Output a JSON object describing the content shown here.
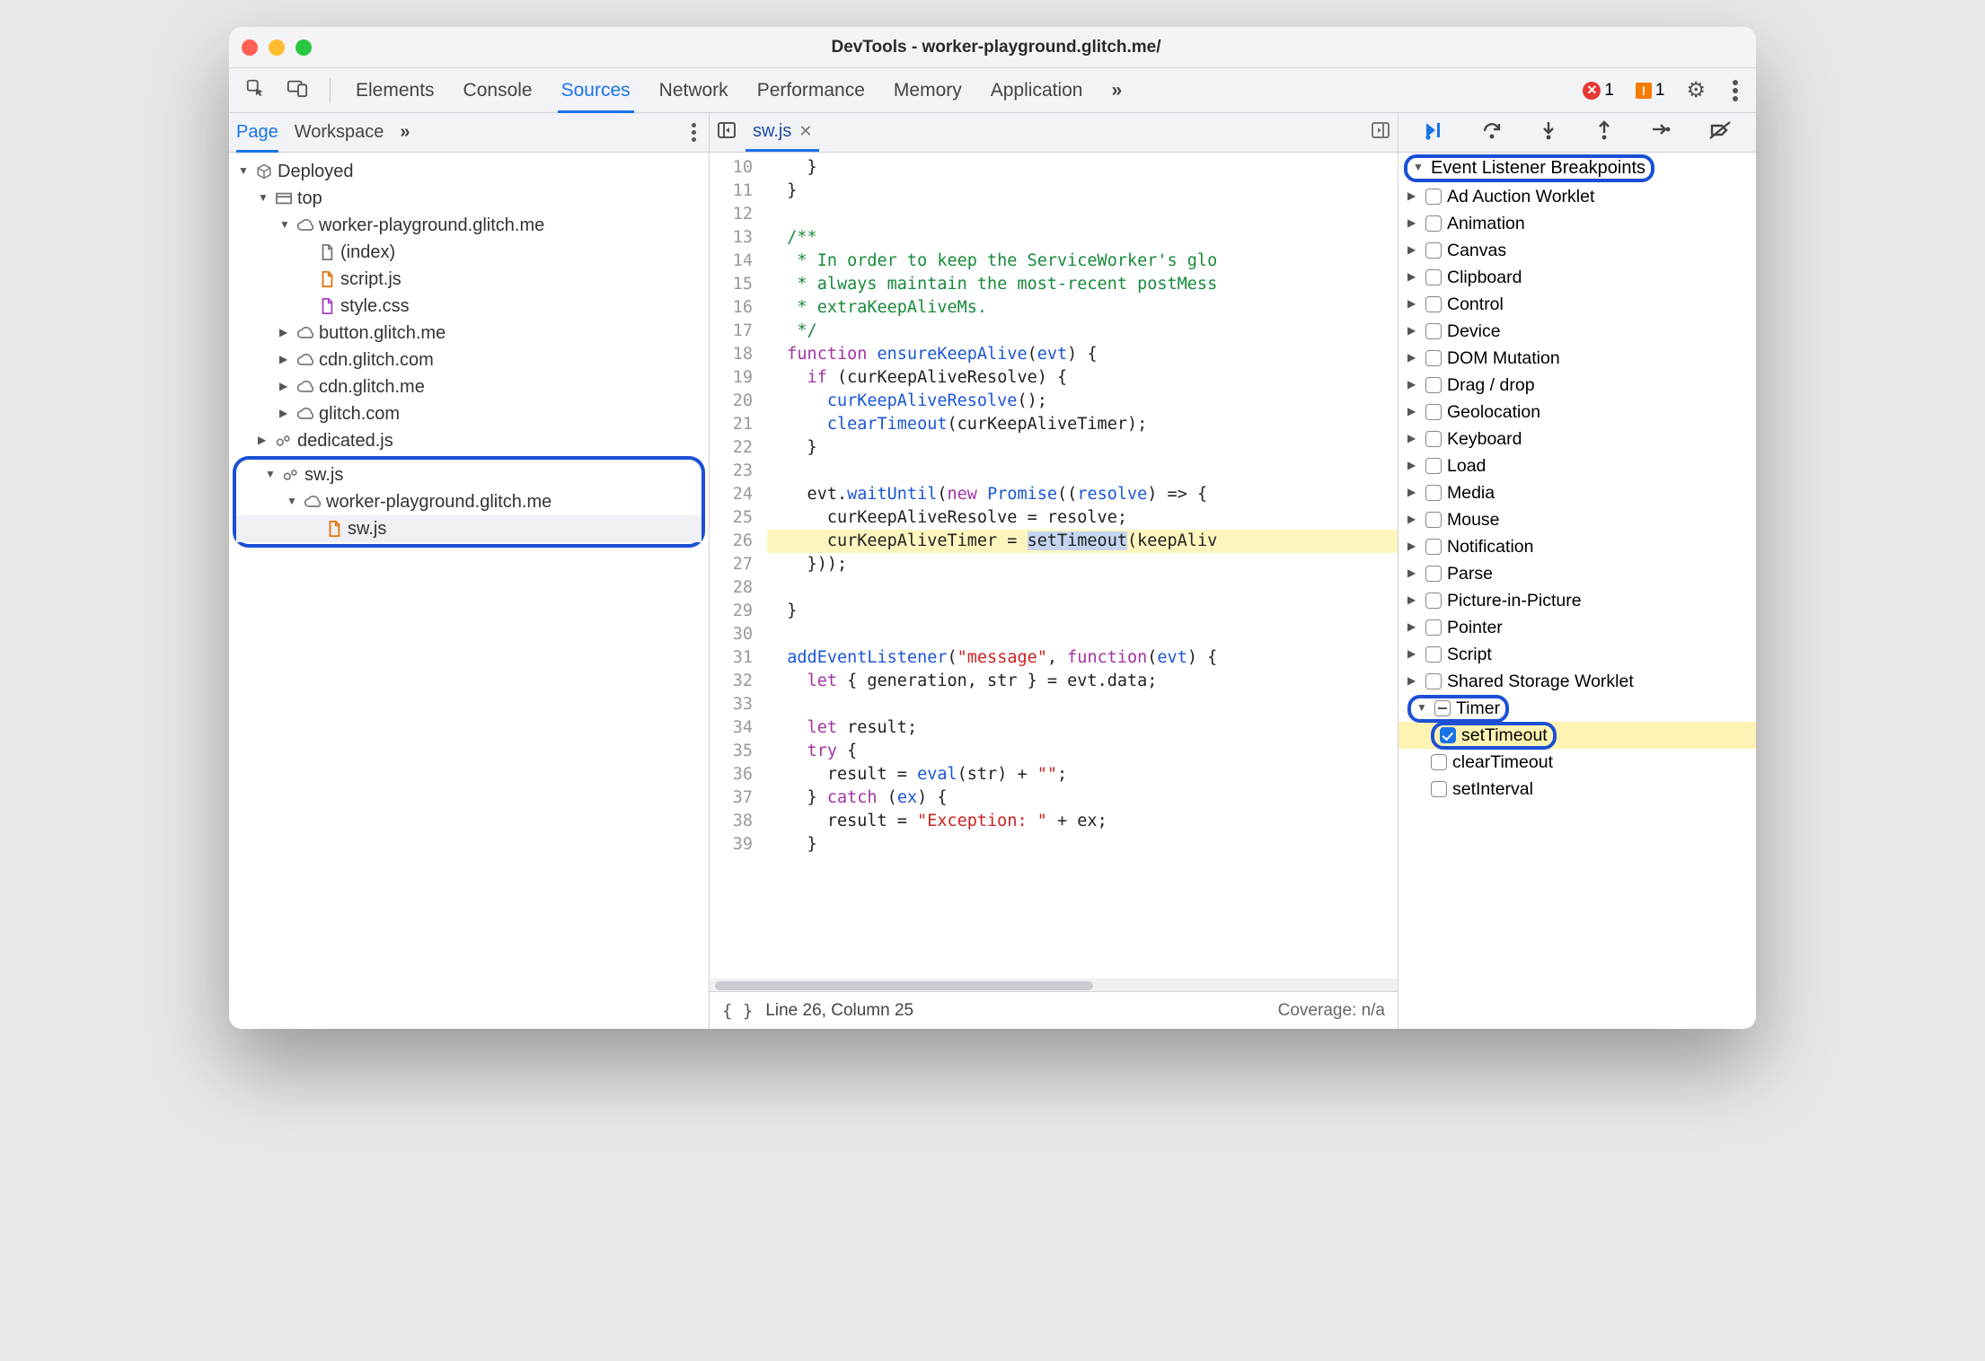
{
  "window": {
    "title": "DevTools - worker-playground.glitch.me/"
  },
  "toptabs": {
    "elements": "Elements",
    "console": "Console",
    "sources": "Sources",
    "network": "Network",
    "performance": "Performance",
    "memory": "Memory",
    "application": "Application",
    "more": "»",
    "error_count": "1",
    "warn_count": "1"
  },
  "left": {
    "tabs": {
      "page": "Page",
      "workspace": "Workspace",
      "more": "»"
    },
    "tree": {
      "deployed": "Deployed",
      "top": "top",
      "origin1": "worker-playground.glitch.me",
      "files1": [
        "(index)",
        "script.js",
        "style.css"
      ],
      "origins_more": [
        "button.glitch.me",
        "cdn.glitch.com",
        "cdn.glitch.me",
        "glitch.com"
      ],
      "dedicated": "dedicated.js",
      "sw": "sw.js",
      "sw_origin": "worker-playground.glitch.me",
      "sw_file": "sw.js"
    }
  },
  "center": {
    "file_tab": "sw.js",
    "lines": [
      {
        "n": 10,
        "t": "    }"
      },
      {
        "n": 11,
        "t": "  }"
      },
      {
        "n": 12,
        "t": ""
      },
      {
        "n": 13,
        "t": "  /**",
        "cls": "cm"
      },
      {
        "n": 14,
        "t": "   * In order to keep the ServiceWorker's glo",
        "cls": "cm"
      },
      {
        "n": 15,
        "t": "   * always maintain the most-recent postMess",
        "cls": "cm"
      },
      {
        "n": 16,
        "t": "   * extraKeepAliveMs.",
        "cls": "cm"
      },
      {
        "n": 17,
        "t": "   */",
        "cls": "cm"
      },
      {
        "n": 18,
        "html": "  <span class='kw'>function</span> <span class='fn'>ensureKeepAlive</span>(<span class='fn'>evt</span>) {"
      },
      {
        "n": 19,
        "html": "    <span class='kw'>if</span> (curKeepAliveResolve) {"
      },
      {
        "n": 20,
        "html": "      <span class='fn'>curKeepAliveResolve</span>();"
      },
      {
        "n": 21,
        "html": "      <span class='fn'>clearTimeout</span>(curKeepAliveTimer);"
      },
      {
        "n": 22,
        "t": "    }"
      },
      {
        "n": 23,
        "t": ""
      },
      {
        "n": 24,
        "html": "    evt.<span class='fn'>waitUntil</span>(<span class='kw'>new</span> <span class='fn'>Promise</span>((<span class='fn'>resolve</span>) =&gt; {"
      },
      {
        "n": 25,
        "html": "      curKeepAliveResolve = resolve;"
      },
      {
        "n": 26,
        "html": "      curKeepAliveTimer = <span class='token-hl'>setTimeout</span>(keepAliv",
        "paused": true
      },
      {
        "n": 27,
        "t": "    }));"
      },
      {
        "n": 28,
        "t": ""
      },
      {
        "n": 29,
        "t": "  }"
      },
      {
        "n": 30,
        "t": ""
      },
      {
        "n": 31,
        "html": "  <span class='fn'>addEventListener</span>(<span class='str'>\"message\"</span>, <span class='kw'>function</span>(<span class='fn'>evt</span>) {"
      },
      {
        "n": 32,
        "html": "    <span class='kw'>let</span> { generation, str } = evt.data;"
      },
      {
        "n": 33,
        "t": ""
      },
      {
        "n": 34,
        "html": "    <span class='kw'>let</span> result;"
      },
      {
        "n": 35,
        "html": "    <span class='kw'>try</span> {"
      },
      {
        "n": 36,
        "html": "      result = <span class='fn'>eval</span>(str) + <span class='str'>\"\"</span>;"
      },
      {
        "n": 37,
        "html": "    } <span class='kw'>catch</span> (<span class='fn'>ex</span>) {"
      },
      {
        "n": 38,
        "html": "      result = <span class='str'>\"Exception: \"</span> + ex;"
      },
      {
        "n": 39,
        "t": "    }"
      }
    ],
    "status": {
      "pos": "Line 26, Column 25",
      "coverage": "Coverage: n/a"
    }
  },
  "right": {
    "section_title": "Event Listener Breakpoints",
    "categories": [
      "Ad Auction Worklet",
      "Animation",
      "Canvas",
      "Clipboard",
      "Control",
      "Device",
      "DOM Mutation",
      "Drag / drop",
      "Geolocation",
      "Keyboard",
      "Load",
      "Media",
      "Mouse",
      "Notification",
      "Parse",
      "Picture-in-Picture",
      "Pointer",
      "Script",
      "Shared Storage Worklet"
    ],
    "timer": {
      "label": "Timer",
      "children": [
        {
          "label": "setTimeout",
          "checked": true
        },
        {
          "label": "clearTimeout",
          "checked": false
        },
        {
          "label": "setInterval",
          "checked": false
        }
      ]
    }
  }
}
